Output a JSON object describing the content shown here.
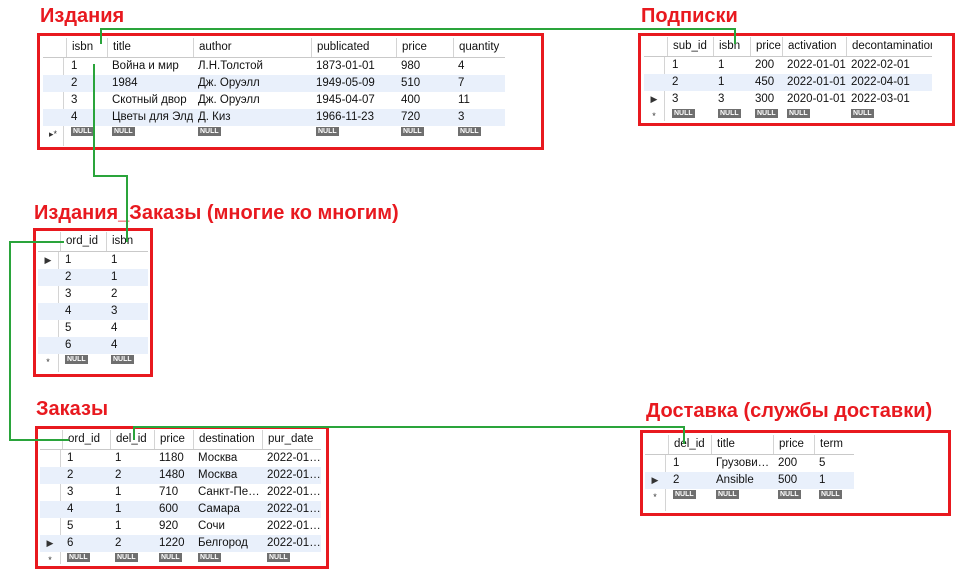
{
  "titles": {
    "publications": "Издания",
    "subscriptions": "Подписки",
    "publications_orders": "Издания_Заказы (многие ко многим)",
    "orders": "Заказы",
    "delivery": "Доставка (службы доставки)"
  },
  "null_text": "NULL",
  "publications": {
    "columns": [
      "isbn",
      "title",
      "author",
      "publicated",
      "price",
      "quantity"
    ],
    "rows": [
      [
        "1",
        "Война и мир",
        "Л.Н.Толстой",
        "1873-01-01",
        "980",
        "4"
      ],
      [
        "2",
        "1984",
        "Дж. Оруэлл",
        "1949-05-09",
        "510",
        "7"
      ],
      [
        "3",
        "Скотный двор",
        "Дж. Оруэлл",
        "1945-04-07",
        "400",
        "11"
      ],
      [
        "4",
        "Цветы для Элджер…",
        "Д. Киз",
        "1966-11-23",
        "720",
        "3"
      ]
    ]
  },
  "subscriptions": {
    "columns": [
      "sub_id",
      "isbn",
      "price",
      "activation",
      "decontamination"
    ],
    "rows": [
      [
        "1",
        "1",
        "200",
        "2022-01-01",
        "2022-02-01"
      ],
      [
        "2",
        "1",
        "450",
        "2022-01-01",
        "2022-04-01"
      ],
      [
        "3",
        "3",
        "300",
        "2020-01-01",
        "2022-03-01"
      ]
    ]
  },
  "publications_orders": {
    "columns": [
      "ord_id",
      "isbn"
    ],
    "rows": [
      [
        "1",
        "1"
      ],
      [
        "2",
        "1"
      ],
      [
        "3",
        "2"
      ],
      [
        "4",
        "3"
      ],
      [
        "5",
        "4"
      ],
      [
        "6",
        "4"
      ]
    ]
  },
  "orders": {
    "columns": [
      "ord_id",
      "del_id",
      "price",
      "destination",
      "pur_date"
    ],
    "rows": [
      [
        "1",
        "1",
        "1180",
        "Москва",
        "2022-01…"
      ],
      [
        "2",
        "2",
        "1480",
        "Москва",
        "2022-01…"
      ],
      [
        "3",
        "1",
        "710",
        "Санкт-Пе…",
        "2022-01…"
      ],
      [
        "4",
        "1",
        "600",
        "Самара",
        "2022-01…"
      ],
      [
        "5",
        "1",
        "920",
        "Сочи",
        "2022-01…"
      ],
      [
        "6",
        "2",
        "1220",
        "Белгород",
        "2022-01…"
      ]
    ]
  },
  "delivery": {
    "columns": [
      "del_id",
      "title",
      "price",
      "term"
    ],
    "rows": [
      [
        "1",
        "Грузови…",
        "200",
        "5"
      ],
      [
        "2",
        "Ansible",
        "500",
        "1"
      ]
    ]
  },
  "colors": {
    "frame": "#e8191f",
    "link": "#2aa43b",
    "row_alt": "#e9f0fb",
    "null_badge": "#6f6f6f"
  }
}
